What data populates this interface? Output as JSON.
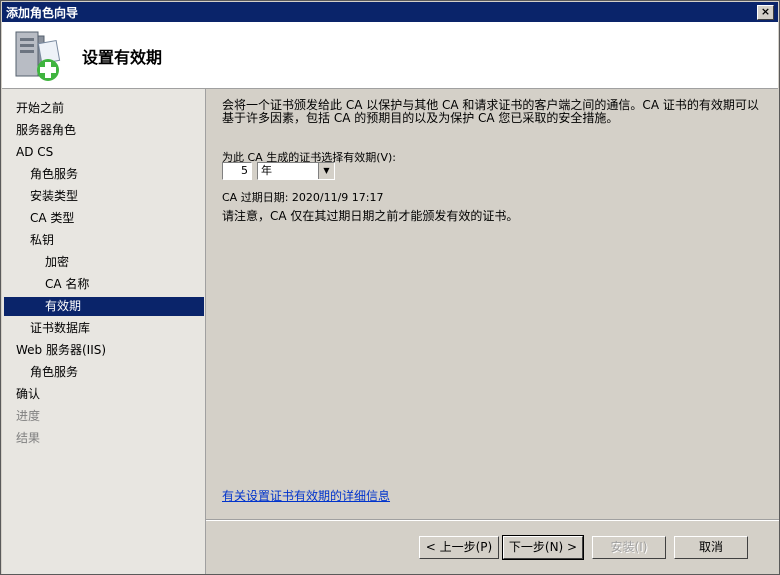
{
  "window": {
    "title": "添加角色向导",
    "close_label": "×"
  },
  "header": {
    "title": "设置有效期",
    "icon": "server-add-icon"
  },
  "nav": {
    "items": [
      {
        "label": "开始之前",
        "level": 0,
        "state": "normal"
      },
      {
        "label": "服务器角色",
        "level": 0,
        "state": "normal"
      },
      {
        "label": "AD CS",
        "level": 0,
        "state": "normal"
      },
      {
        "label": "角色服务",
        "level": 1,
        "state": "normal"
      },
      {
        "label": "安装类型",
        "level": 1,
        "state": "normal"
      },
      {
        "label": "CA 类型",
        "level": 1,
        "state": "normal"
      },
      {
        "label": "私钥",
        "level": 1,
        "state": "normal"
      },
      {
        "label": "加密",
        "level": 2,
        "state": "normal"
      },
      {
        "label": "CA 名称",
        "level": 2,
        "state": "normal"
      },
      {
        "label": "有效期",
        "level": 2,
        "state": "selected"
      },
      {
        "label": "证书数据库",
        "level": 1,
        "state": "normal"
      },
      {
        "label": "Web 服务器(IIS)",
        "level": 0,
        "state": "normal"
      },
      {
        "label": "角色服务",
        "level": 1,
        "state": "normal"
      },
      {
        "label": "确认",
        "level": 0,
        "state": "normal"
      },
      {
        "label": "进度",
        "level": 0,
        "state": "disabled"
      },
      {
        "label": "结果",
        "level": 0,
        "state": "disabled"
      }
    ]
  },
  "content": {
    "description": "会将一个证书颁发给此 CA 以保护与其他 CA 和请求证书的客户端之间的通信。CA 证书的有效期可以基于许多因素，包括 CA 的预期目的以及为保护 CA 您已采取的安全措施。",
    "period_label": "为此 CA 生成的证书选择有效期(V):",
    "period_value": "5",
    "period_unit": "年",
    "expire_text": "CA 过期日期:  2020/11/9 17:17",
    "note": "请注意，CA 仅在其过期日期之前才能颁发有效的证书。",
    "more_link": "有关设置证书有效期的详细信息"
  },
  "buttons": {
    "back": "< 上一步(P)",
    "next": "下一步(N) >",
    "install": "安装(I)",
    "cancel": "取消"
  }
}
